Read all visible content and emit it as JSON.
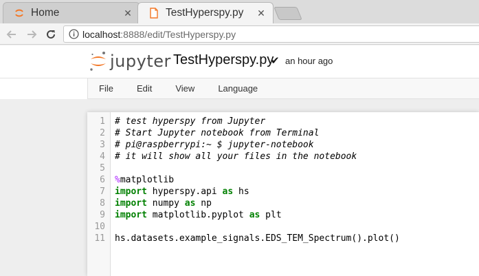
{
  "browser": {
    "tabs": [
      {
        "title": "Home",
        "state": "inactive"
      },
      {
        "title": "TestHyperspy.py",
        "state": "active"
      }
    ],
    "address": {
      "host": "localhost",
      "path": ":8888/edit/TestHyperspy.py"
    },
    "icons": {
      "back": "back-arrow-icon",
      "forward": "forward-arrow-icon",
      "reload": "reload-icon",
      "info": "info-icon",
      "close": "close-icon"
    }
  },
  "jupyter": {
    "logo_text": "jupyter",
    "file_title": "TestHyperspy.py",
    "save_status": "an hour ago",
    "menu": [
      "File",
      "Edit",
      "View",
      "Language"
    ],
    "brand_color": "#f37726"
  },
  "editor": {
    "lines": [
      {
        "num": "1",
        "text": "# test hyperspy from Jupyter"
      },
      {
        "num": "2",
        "text": "# Start Jupyter notebook from Terminal"
      },
      {
        "num": "3",
        "text": "# pi@raspberrypi:~ $ jupyter-notebook"
      },
      {
        "num": "4",
        "text": "# it will show all your files in the notebook"
      },
      {
        "num": "5",
        "text": ""
      },
      {
        "num": "6",
        "magic": "%",
        "rest": "matplotlib"
      },
      {
        "num": "7",
        "kw": "import",
        "a": " hyperspy.api ",
        "kw2": "as",
        "b": " hs"
      },
      {
        "num": "8",
        "kw": "import",
        "a": " numpy ",
        "kw2": "as",
        "b": " np"
      },
      {
        "num": "9",
        "kw": "import",
        "a": " matplotlib.pyplot ",
        "kw2": "as",
        "b": " plt"
      },
      {
        "num": "10",
        "text": ""
      },
      {
        "num": "11",
        "text": "hs.datasets.example_signals.EDS_TEM_Spectrum().plot()"
      }
    ],
    "colors": {
      "comment": "#408080",
      "keyword": "#008000",
      "magic": "#aa22ff"
    }
  }
}
